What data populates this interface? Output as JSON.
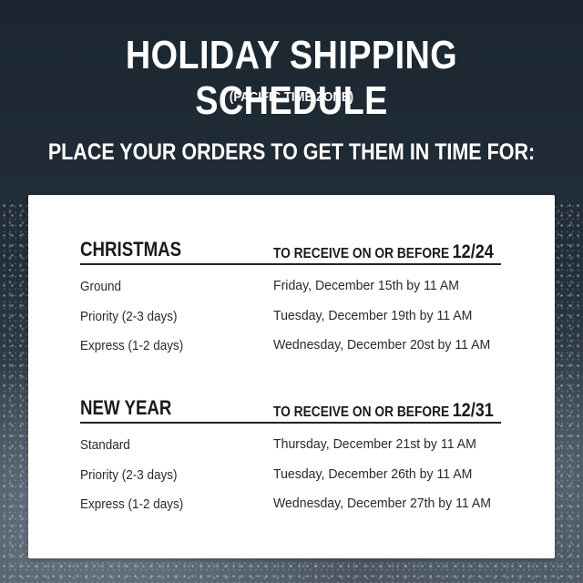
{
  "title": "HOLIDAY SHIPPING SCHEDULE",
  "subtitle": "(PACIFIC TIME ZONE)",
  "instruction": "PLACE YOUR ORDERS TO GET THEM IN TIME FOR:",
  "sections": [
    {
      "name": "CHRISTMAS",
      "receive_label": "TO RECEIVE ON OR BEFORE",
      "receive_date": "12/24",
      "rows": [
        {
          "method": "Ground",
          "deadline": "Friday, December 15th by 11 AM"
        },
        {
          "method": "Priority (2-3 days)",
          "deadline": "Tuesday, December 19th by 11 AM"
        },
        {
          "method": "Express (1-2 days)",
          "deadline": "Wednesday, December 20st by 11 AM"
        }
      ]
    },
    {
      "name": "NEW YEAR",
      "receive_label": "TO RECEIVE ON OR BEFORE",
      "receive_date": "12/31",
      "rows": [
        {
          "method": "Standard",
          "deadline": "Thursday, December 21st by 11 AM"
        },
        {
          "method": "Priority (2-3 days)",
          "deadline": "Tuesday, December 26th by 11 AM"
        },
        {
          "method": "Express (1-2 days)",
          "deadline": "Wednesday, December 27th by 11 AM"
        }
      ]
    }
  ],
  "colors": {
    "background": "#1f2a33",
    "card": "#ffffff",
    "heading_text": "#ffffff",
    "body_text": "#2a2a2a"
  }
}
